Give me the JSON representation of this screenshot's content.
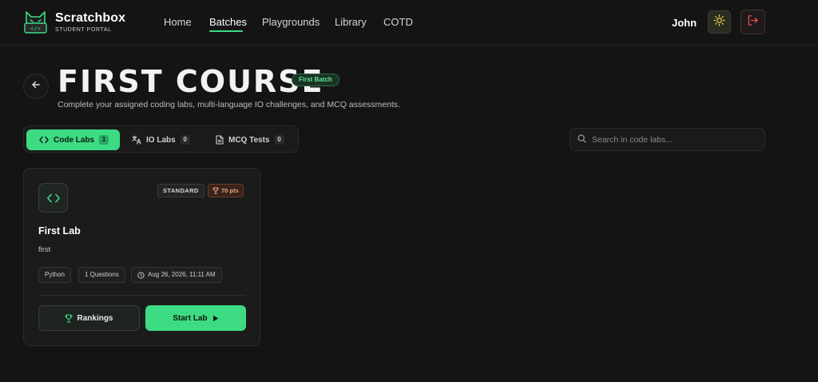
{
  "brand": {
    "name": "Scratchbox",
    "subtitle": "STUDENT PORTAL",
    "logo_icon": "cat-terminal-icon"
  },
  "nav": {
    "items": [
      {
        "label": "Home"
      },
      {
        "label": "Batches"
      },
      {
        "label": "Playgrounds"
      },
      {
        "label": "Library"
      },
      {
        "label": "COTD"
      }
    ],
    "active": "Batches"
  },
  "user": {
    "name": "John",
    "theme_icon": "sun-icon",
    "logout_icon": "logout-icon"
  },
  "page": {
    "title": "FIRST COURSE",
    "batch_badge": "First Batch",
    "subtitle": "Complete your assigned coding labs, multi-language IO challenges, and MCQ assessments."
  },
  "tabs": [
    {
      "label": "Code Labs",
      "count": "1",
      "icon": "code-icon"
    },
    {
      "label": "IO Labs",
      "count": "0",
      "icon": "translate-icon"
    },
    {
      "label": "MCQ Tests",
      "count": "0",
      "icon": "document-icon"
    }
  ],
  "search": {
    "placeholder": "Search in code labs..."
  },
  "lab_card": {
    "difficulty": "STANDARD",
    "points": "70 pts",
    "title": "First Lab",
    "description": "first",
    "language": "Python",
    "questions": "1 Questions",
    "date": "Aug 26, 2026, 11:11 AM",
    "rankings_label": "Rankings",
    "start_label": "Start Lab"
  },
  "colors": {
    "background": "#141414",
    "accent": "#3ddc84",
    "points_text": "#f4a57a",
    "logout_red": "#e05050"
  }
}
